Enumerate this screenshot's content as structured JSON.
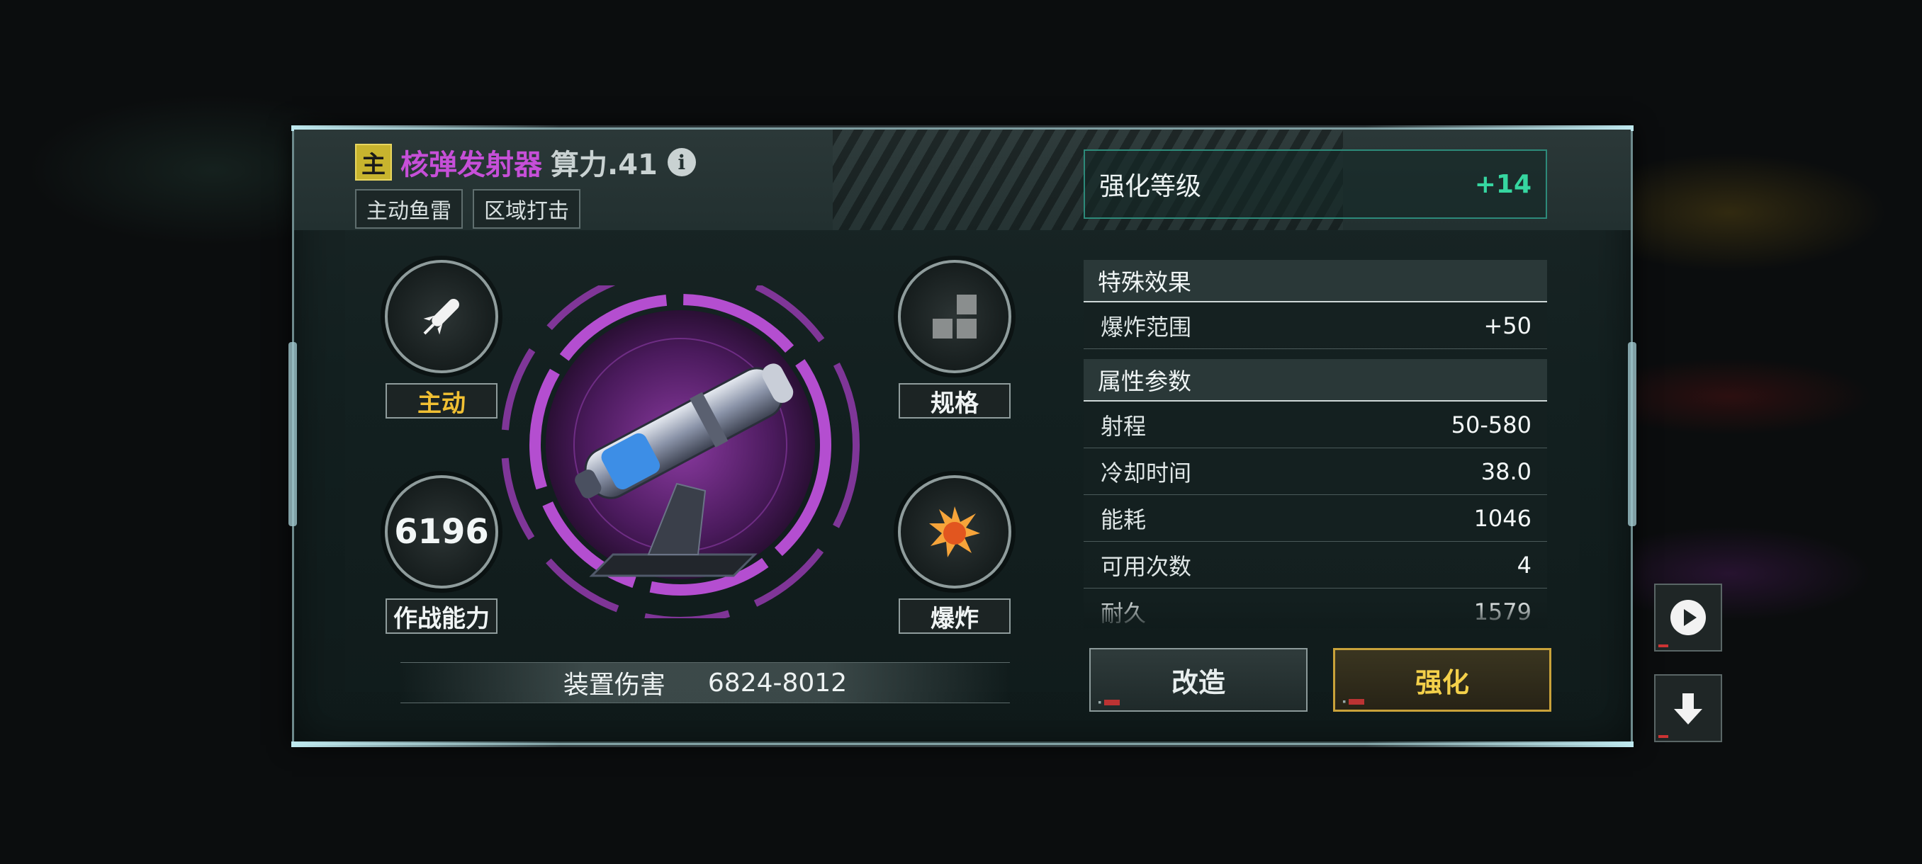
{
  "weapon": {
    "badge": "主",
    "name": "核弹发射器",
    "power": "算力.41",
    "info_icon": "i",
    "tags": [
      "主动鱼雷",
      "区域打击"
    ]
  },
  "enhancement": {
    "label": "强化等级",
    "value": "+14"
  },
  "special_effects": {
    "title": "特殊效果",
    "rows": [
      {
        "label": "爆炸范围",
        "value": "+50"
      }
    ]
  },
  "attributes": {
    "title": "属性参数",
    "rows": [
      {
        "label": "射程",
        "value": "50-580"
      },
      {
        "label": "冷却时间",
        "value": "38.0"
      },
      {
        "label": "能耗",
        "value": "1046"
      },
      {
        "label": "可用次数",
        "value": "4"
      },
      {
        "label": "耐久",
        "value": "1579"
      }
    ]
  },
  "skills": {
    "active": {
      "label": "主动",
      "icon": "missile-icon"
    },
    "spec": {
      "label": "规格",
      "icon": "grid-blocks-icon"
    },
    "combat": {
      "label": "作战能力",
      "value": "6196"
    },
    "explosion": {
      "label": "爆炸",
      "icon": "explosion-icon"
    }
  },
  "damage": {
    "label": "装置伤害",
    "value": "6824-8012"
  },
  "buttons": {
    "modify": "改造",
    "enhance": "强化"
  },
  "side_buttons": [
    "play-icon",
    "download-arrow-icon"
  ],
  "colors": {
    "accent_purple": "#c64fd8",
    "enhance_green": "#36d6a0",
    "gold": "#f3d04a",
    "active_yellow": "#f1c033"
  }
}
